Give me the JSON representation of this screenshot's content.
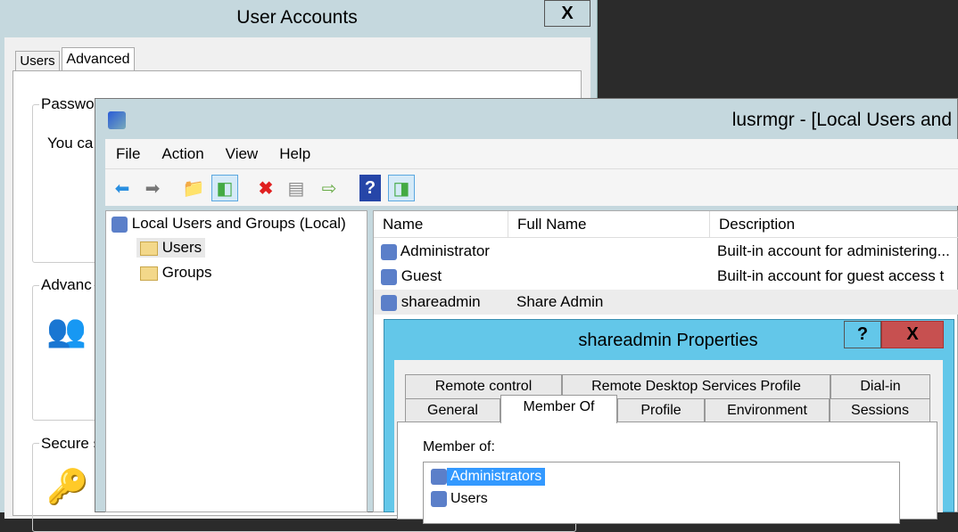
{
  "user_accounts": {
    "title": "User Accounts",
    "close": "X",
    "tabs": [
      "Users",
      "Advanced"
    ],
    "groups": [
      "Passwo",
      "Advanc",
      "Secure s"
    ],
    "text": "You ca"
  },
  "lusrmgr": {
    "title": "lusrmgr - [Local Users and",
    "menu": [
      "File",
      "Action",
      "View",
      "Help"
    ],
    "tree": {
      "root": "Local Users and Groups (Local)",
      "children": [
        "Users",
        "Groups"
      ]
    },
    "columns": [
      "Name",
      "Full Name",
      "Description"
    ],
    "rows": [
      {
        "name": "Administrator",
        "full_name": "",
        "description": "Built-in account for administering..."
      },
      {
        "name": "Guest",
        "full_name": "",
        "description": "Built-in account for guest access t"
      },
      {
        "name": "shareadmin",
        "full_name": "Share Admin",
        "description": ""
      }
    ]
  },
  "properties": {
    "title": "shareadmin Properties",
    "help": "?",
    "close": "X",
    "tabs_row1": [
      "Remote control",
      "Remote Desktop Services Profile",
      "Dial-in"
    ],
    "tabs_row2": [
      "General",
      "Member Of",
      "Profile",
      "Environment",
      "Sessions"
    ],
    "member_of_label": "Member of:",
    "groups": [
      "Administrators",
      "Users"
    ],
    "selected_color": "#3399ff"
  }
}
